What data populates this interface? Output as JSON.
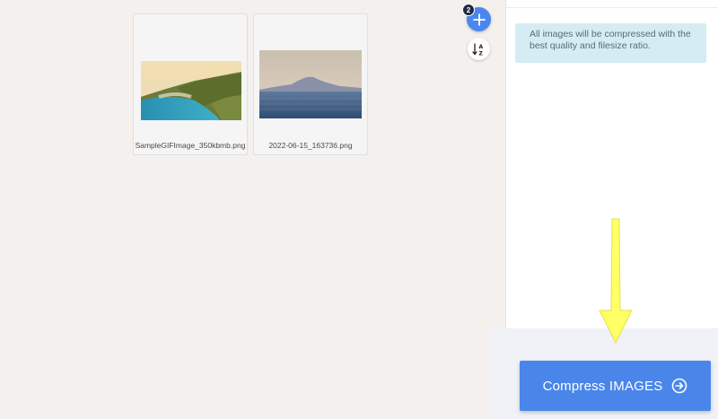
{
  "files": [
    {
      "name": "SampleGIFImage_350kbmb.png",
      "thumbnail": "coastal-cliffs-photo"
    },
    {
      "name": "2022-06-15_163736.png",
      "thumbnail": "mountain-sea-photo"
    }
  ],
  "toolbar": {
    "file_count": "2",
    "add_icon": "plus-icon",
    "sort_icon": "sort-az-icon"
  },
  "sidebar": {
    "info_text": "All images will be compressed with the best quality and filesize ratio."
  },
  "action": {
    "compress_label": "Compress IMAGES",
    "compress_icon": "arrow-right-circle-icon"
  },
  "colors": {
    "accent": "#4a86ea",
    "info_bg": "#d5ecf3",
    "background": "#f4f0ed",
    "annotation_arrow": "#ffff66"
  }
}
